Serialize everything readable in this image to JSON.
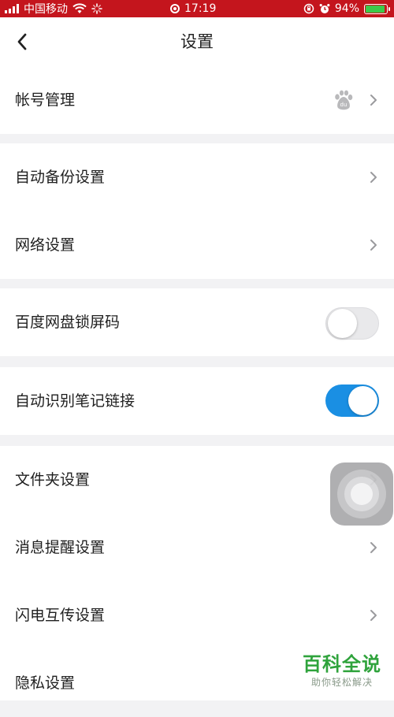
{
  "status_bar": {
    "carrier": "中国移动",
    "time": "17:19",
    "battery": "94%",
    "battery_level_percent": 94
  },
  "header": {
    "back_icon": "chevron-left-icon",
    "title": "设置"
  },
  "settings": {
    "account": {
      "label": "帐号管理",
      "icon": "baidu-paw-icon"
    },
    "auto_backup": {
      "label": "自动备份设置"
    },
    "network": {
      "label": "网络设置"
    },
    "lock_screen": {
      "label": "百度网盘锁屏码",
      "enabled": false
    },
    "note_link": {
      "label": "自动识别笔记链接",
      "enabled": true
    },
    "folder": {
      "label": "文件夹设置"
    },
    "notification": {
      "label": "消息提醒设置"
    },
    "flash_transfer": {
      "label": "闪电互传设置"
    },
    "privacy": {
      "label": "隐私设置"
    }
  },
  "colors": {
    "status_bar": "#c4151d",
    "toggle_on": "#1a8fe3",
    "toggle_off": "#e9e9eb",
    "watermark": "#2fa33c"
  },
  "watermark": {
    "title": "百科全说",
    "subtitle": "助你轻松解决"
  }
}
